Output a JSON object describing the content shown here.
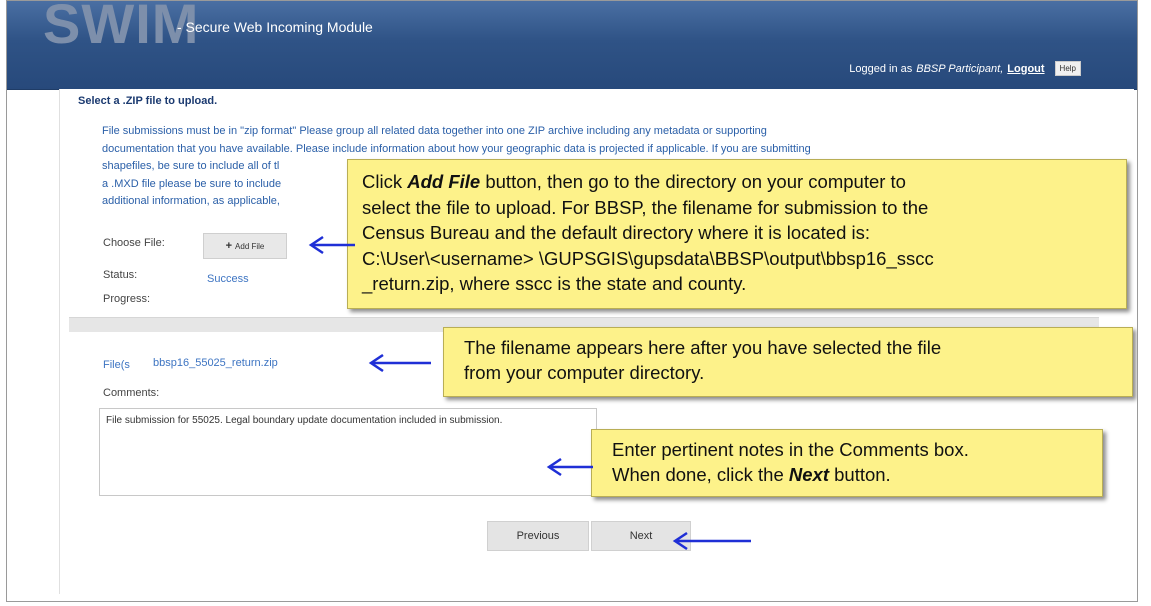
{
  "app": {
    "logo": "SWIM",
    "subtitle": "- Secure Web Incoming Module"
  },
  "login": {
    "prefix": "Logged in as",
    "user": "BBSP Participant",
    "separator": ",",
    "logout": "Logout",
    "help": "Help"
  },
  "page": {
    "title": "Select a .ZIP file to upload.",
    "intro_lines": [
      "File submissions must be in \"zip format\" Please group all related data together into one ZIP archive including any metadata or supporting",
      "documentation that you have available. Please include information about how your geographic data is projected if applicable. If you are submitting",
      "shapefiles, be sure to include all of tl",
      "a .MXD file please be sure to include",
      "additional information, as applicable,"
    ]
  },
  "form": {
    "choose_label": "Choose File:",
    "add_file_label": "Add File",
    "status_label": "Status:",
    "status_value": "Success",
    "progress_label": "Progress:",
    "files_label": "File(s",
    "file_name": "bbsp16_55025_return.zip",
    "comments_label": "Comments:",
    "comments_value": "File submission for 55025.  Legal boundary update documentation included in submission.",
    "previous_label": "Previous",
    "next_label": "Next"
  },
  "callouts": {
    "c1_lines": [
      "button, then go to the directory on your computer to",
      "select the file to upload.  For BBSP, the filename for submission to the",
      "Census Bureau and the  default directory where it is located is:",
      "C:\\User\\<username> \\GUPSGIS\\gupsdata\\BBSP\\output\\bbsp16_sscc",
      "_return.zip, where sscc is the state and county."
    ],
    "c1_prefix": "Click",
    "c1_bold": "Add File",
    "c2_lines": [
      "The filename appears here after you have selected the file",
      "from your computer directory."
    ],
    "c3_line1": "Enter pertinent notes in the Comments box.",
    "c3_prefix": "When done, click the",
    "c3_bold": "Next",
    "c3_suffix": "button."
  },
  "colors": {
    "header": "#2f5386",
    "callout": "#fdf28a",
    "arrow": "#1f2fd6",
    "link": "#3d74c2"
  }
}
